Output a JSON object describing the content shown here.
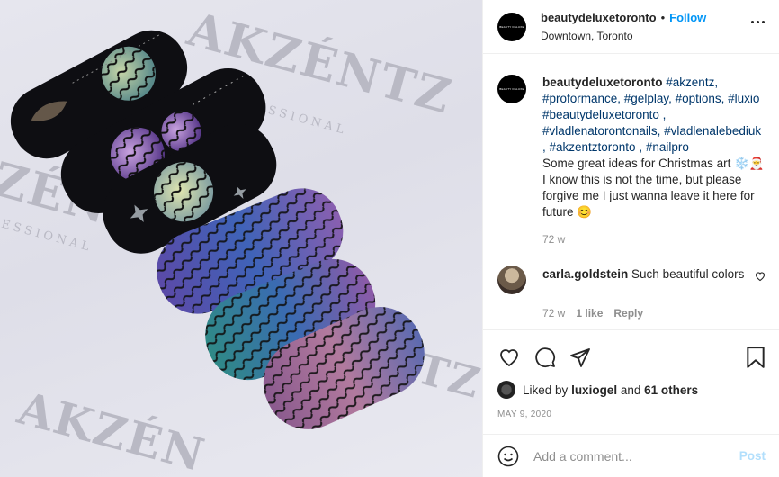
{
  "photo": {
    "watermark_brand": "AKZÉNTZ",
    "watermark_sub": "PROFESSIONAL",
    "watermark_fragments": [
      "ZÉNTZ",
      "ESSIONAL",
      "AKZÉN",
      "NTZ"
    ]
  },
  "header": {
    "avatar_text": "BEAUTY DELUXE",
    "username": "beautydeluxetoronto",
    "separator": "•",
    "follow_label": "Follow",
    "location": "Downtown, Toronto"
  },
  "caption": {
    "username": "beautydeluxetoronto",
    "hashtags_line": "#akzentz, #proformance, #gelplay, #options, #luxio #beautydeluxetoronto , #vladlenatorontonails, #vladlenalebediuk , #akzentztoronto , #nailpro",
    "text": "Some great ideas for Christmas art ❄️🎅 I know this is not the time, but please forgive me I just wanna leave it here for future 😊",
    "time": "72 w"
  },
  "comment": {
    "username": "carla.goldstein",
    "text": "Such beautiful colors",
    "time": "72 w",
    "likes": "1 like",
    "reply_label": "Reply"
  },
  "likes": {
    "prefix": "Liked by",
    "user": "luxiogel",
    "and": "and",
    "others": "61 others"
  },
  "date": "MAY 9, 2020",
  "add_comment": {
    "placeholder": "Add a comment...",
    "post_label": "Post"
  }
}
